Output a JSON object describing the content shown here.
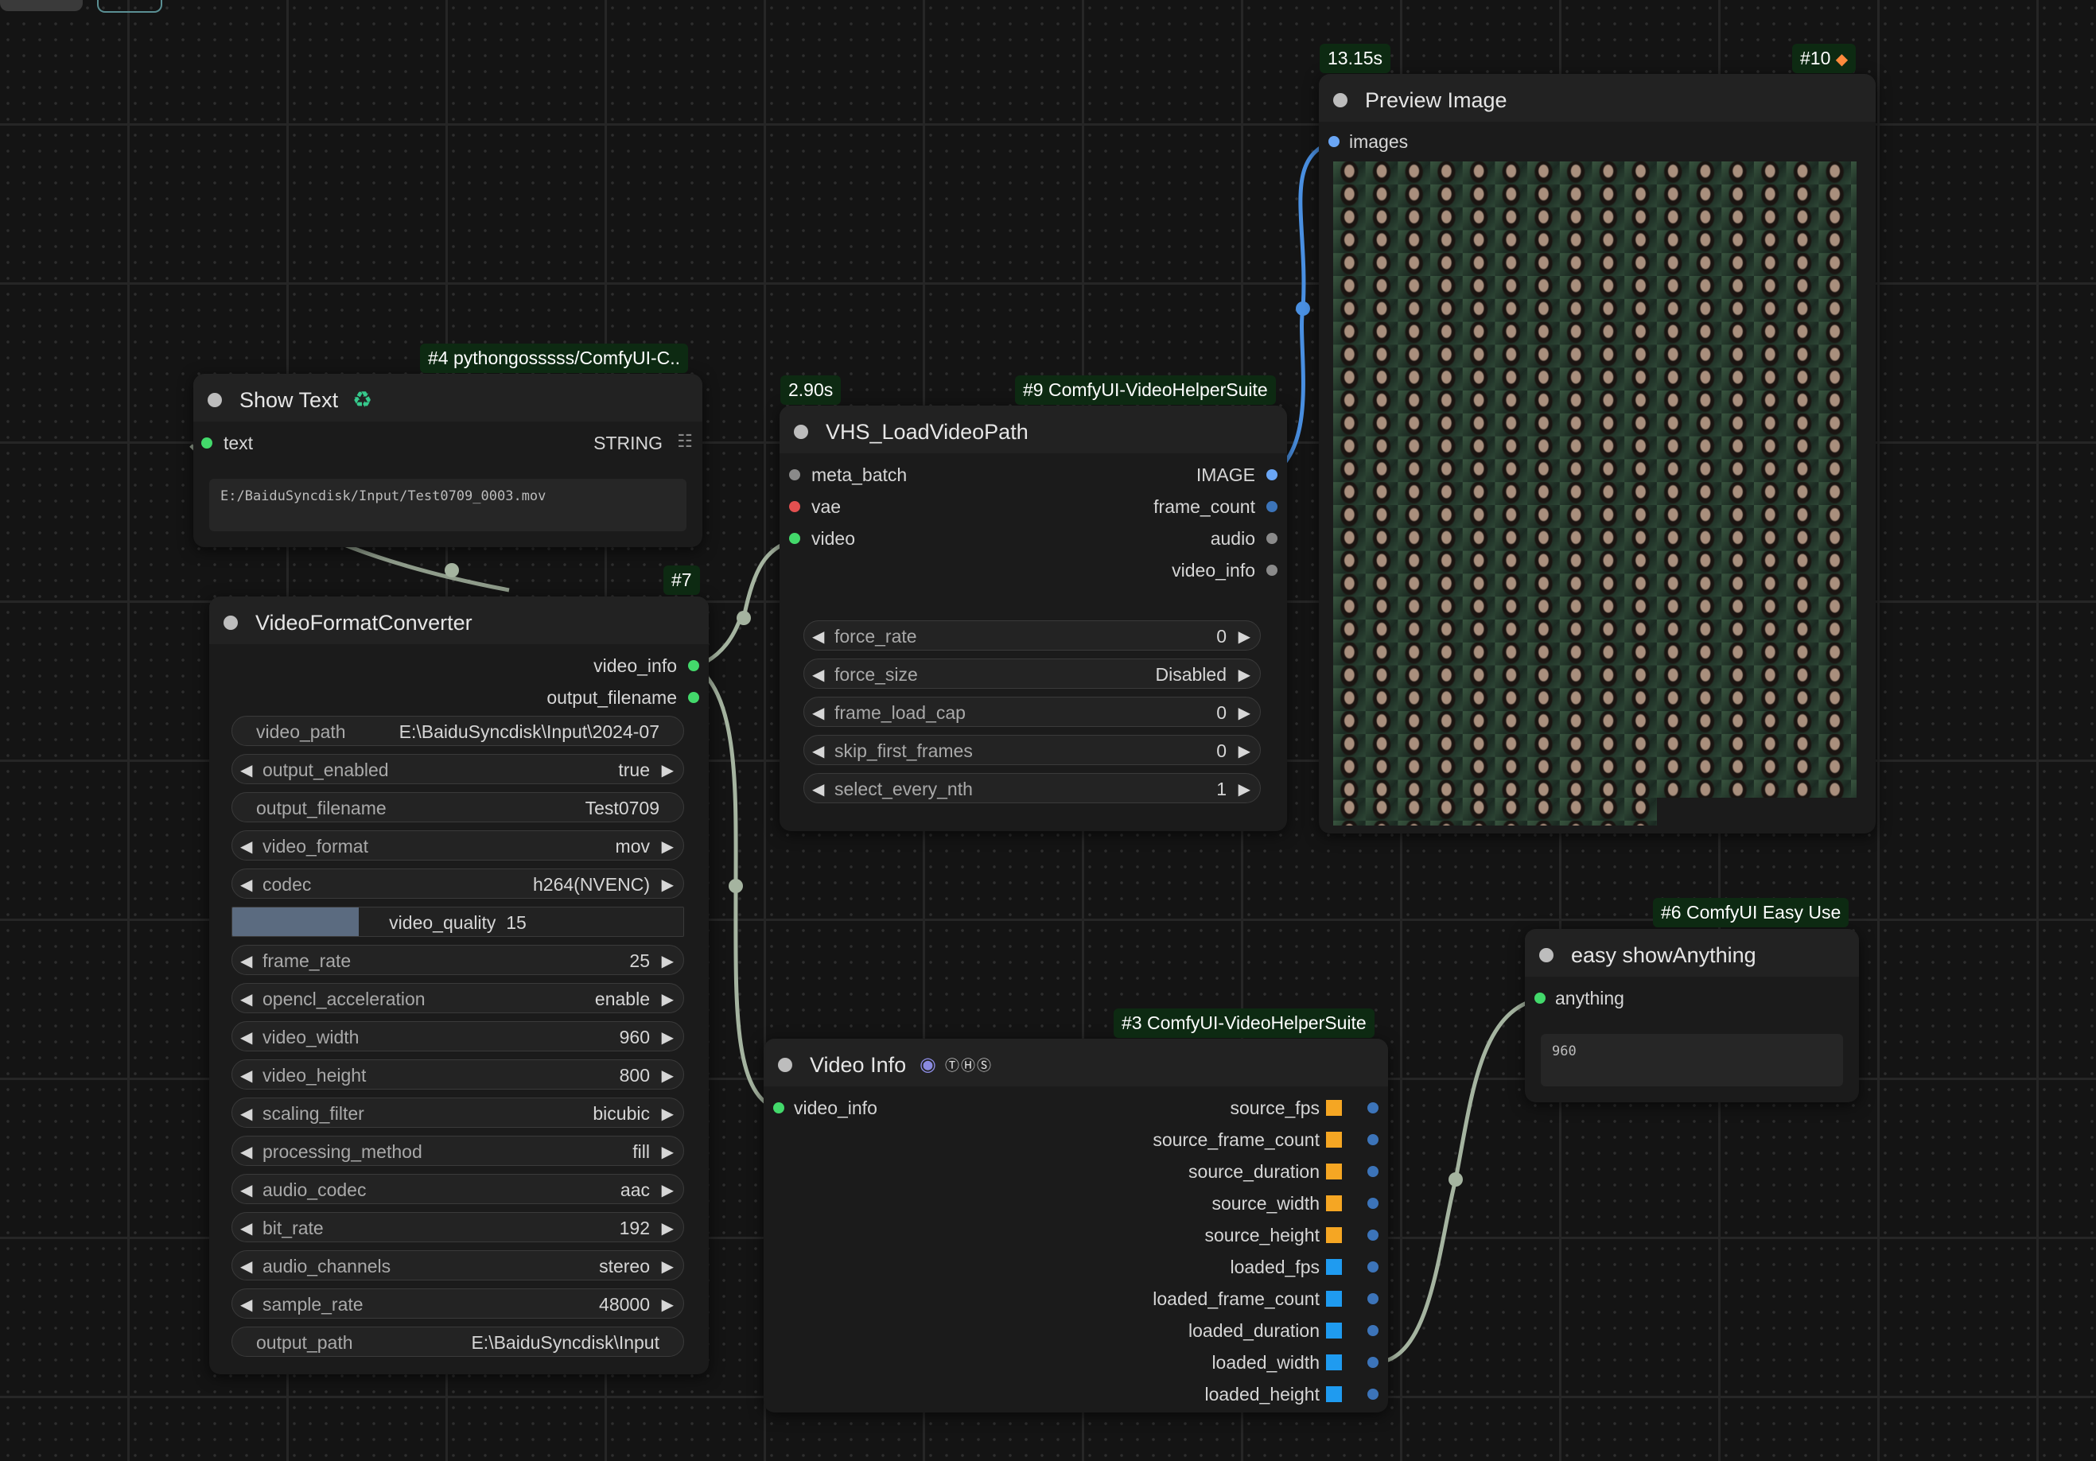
{
  "show_text_node": {
    "badge": "#4 pythongosssss/ComfyUI-C..",
    "title": "Show Text",
    "icon": "recycle-icon",
    "input_label": "text",
    "type_label": "STRING",
    "text_value": "E:/BaiduSyncdisk/Input/Test0709_0003.mov"
  },
  "video_format_converter": {
    "badge": "#7",
    "title": "VideoFormatConverter",
    "outputs": [
      "video_info",
      "output_filename"
    ],
    "widgets": [
      {
        "name": "video_path",
        "value": "E:\\BaiduSyncdisk\\Input\\2024-07",
        "arrows": false
      },
      {
        "name": "output_enabled",
        "value": "true",
        "arrows": true
      },
      {
        "name": "output_filename",
        "value": "Test0709",
        "arrows": false
      },
      {
        "name": "video_format",
        "value": "mov",
        "arrows": true
      },
      {
        "name": "codec",
        "value": "h264(NVENC)",
        "arrows": true
      },
      {
        "name": "video_quality",
        "value": "15",
        "arrows": false,
        "slider_fraction": 0.28
      },
      {
        "name": "frame_rate",
        "value": "25",
        "arrows": true
      },
      {
        "name": "opencl_acceleration",
        "value": "enable",
        "arrows": true
      },
      {
        "name": "video_width",
        "value": "960",
        "arrows": true
      },
      {
        "name": "video_height",
        "value": "800",
        "arrows": true
      },
      {
        "name": "scaling_filter",
        "value": "bicubic",
        "arrows": true
      },
      {
        "name": "processing_method",
        "value": "fill",
        "arrows": true
      },
      {
        "name": "audio_codec",
        "value": "aac",
        "arrows": true
      },
      {
        "name": "bit_rate",
        "value": "192",
        "arrows": true
      },
      {
        "name": "audio_channels",
        "value": "stereo",
        "arrows": true
      },
      {
        "name": "sample_rate",
        "value": "48000",
        "arrows": true
      },
      {
        "name": "output_path",
        "value": "E:\\BaiduSyncdisk\\Input",
        "arrows": false
      }
    ]
  },
  "vhs_load_video_path": {
    "time_badge": "2.90s",
    "badge": "#9 ComfyUI-VideoHelperSuite",
    "title": "VHS_LoadVideoPath",
    "inputs": [
      {
        "name": "meta_batch",
        "color": "#8a8a8a"
      },
      {
        "name": "vae",
        "color": "#e35050"
      },
      {
        "name": "video",
        "color": "#43d96b"
      }
    ],
    "outputs": [
      {
        "name": "IMAGE",
        "color": "#6aa6f5"
      },
      {
        "name": "frame_count",
        "color": "#3c74b9"
      },
      {
        "name": "audio",
        "color": "#8a8a8a"
      },
      {
        "name": "video_info",
        "color": "#8a8a8a"
      }
    ],
    "widgets": [
      {
        "name": "force_rate",
        "value": "0"
      },
      {
        "name": "force_size",
        "value": "Disabled"
      },
      {
        "name": "frame_load_cap",
        "value": "0"
      },
      {
        "name": "skip_first_frames",
        "value": "0"
      },
      {
        "name": "select_every_nth",
        "value": "1"
      }
    ]
  },
  "preview_image": {
    "time_badge": "13.15s",
    "badge": "#10",
    "badge_icon": "fox-icon",
    "title": "Preview Image",
    "input_label": "images"
  },
  "easy_show_anything": {
    "badge": "#6 ComfyUI Easy Use",
    "title": "easy showAnything",
    "input_label": "anything",
    "text_value": "960"
  },
  "video_info_node": {
    "badge": "#3 ComfyUI-VideoHelperSuite",
    "title": "Video Info",
    "title_icons": [
      "camera-icon",
      "vhs-logo-icon"
    ],
    "input_label": "video_info",
    "outputs": [
      {
        "name": "source_fps",
        "square_color": "#f5a623"
      },
      {
        "name": "source_frame_count",
        "square_color": "#f5a623"
      },
      {
        "name": "source_duration",
        "square_color": "#f5a623"
      },
      {
        "name": "source_width",
        "square_color": "#f5a623"
      },
      {
        "name": "source_height",
        "square_color": "#f5a623"
      },
      {
        "name": "loaded_fps",
        "square_color": "#1f9bf0"
      },
      {
        "name": "loaded_frame_count",
        "square_color": "#1f9bf0"
      },
      {
        "name": "loaded_duration",
        "square_color": "#1f9bf0"
      },
      {
        "name": "loaded_width",
        "square_color": "#1f9bf0"
      },
      {
        "name": "loaded_height",
        "square_color": "#1f9bf0"
      }
    ]
  },
  "colors": {
    "canvas": "#141414",
    "node_body": "#1b1b1b",
    "badge_bg": "#0d2a12",
    "link_image": "#4a90e2",
    "link_generic": "#a5b4a0",
    "slot_green": "#43d96b"
  }
}
